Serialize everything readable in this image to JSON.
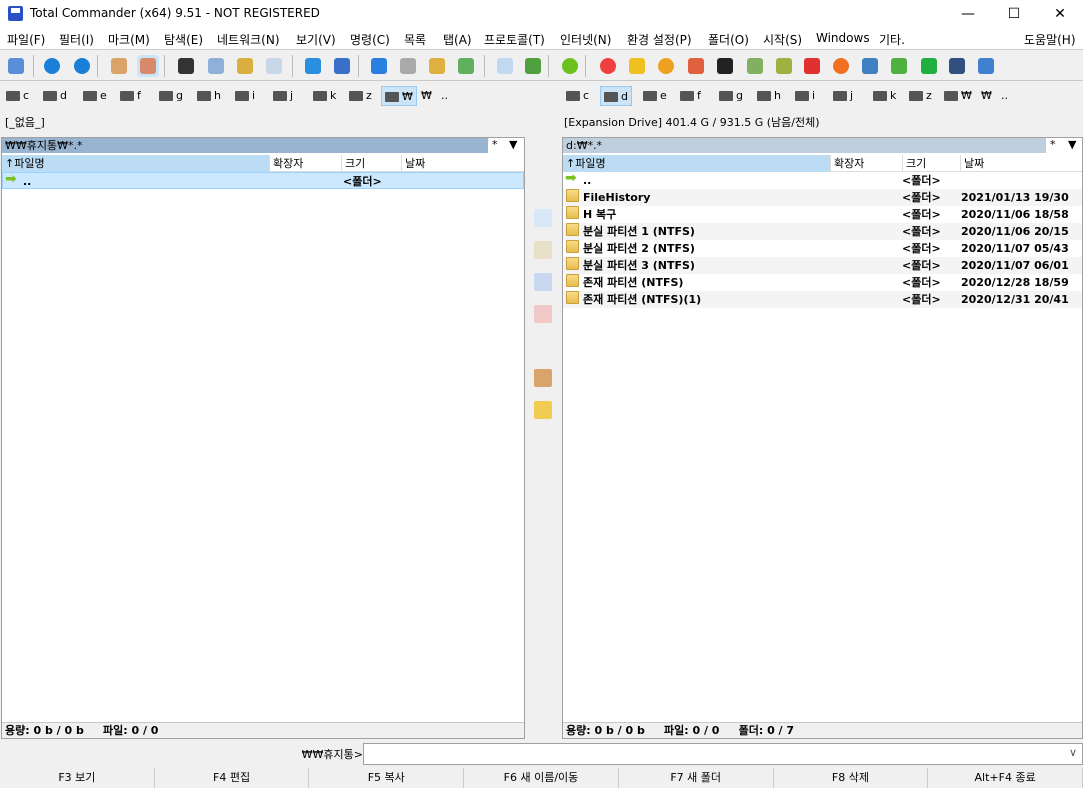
{
  "window": {
    "title": "Total Commander (x64) 9.51 - NOT REGISTERED",
    "minimize": "—",
    "maximize": "☐",
    "close": "✕"
  },
  "menu": [
    "파일(F)",
    "필터(I)",
    "마크(M)",
    "탐색(E)",
    "네트워크(N)",
    "보기(V)",
    "명령(C)",
    "목록",
    "탭(A)",
    "프로토콜(T)",
    "인터넷(N)",
    "환경 설정(P)",
    "폴더(O)",
    "시작(S)",
    "Windows",
    "기타.",
    "도움말(H)"
  ],
  "toolbar_icons": [
    "network-neighborhood-icon",
    "back-icon",
    "forward-icon",
    "pack-icon",
    "unpack-icon",
    "select-icon",
    "multi-rename-icon",
    "kb-icon",
    "attributes-icon",
    "internet-explorer-icon",
    "ftp-icon",
    "info-icon",
    "find-icon",
    "sync-icon",
    "compare-icon",
    "quick-view-icon",
    "image-icon",
    "green-circle-icon",
    "ring-icon",
    "player-icon",
    "launcher-icon",
    "eye-icon",
    "pdf-icon",
    "notepad-icon",
    "drop-icon",
    "paint-icon",
    "firefox-icon",
    "download-icon",
    "utorrent-icon",
    "64-icon",
    "terminal-icon",
    "settings-search-icon"
  ],
  "drives": [
    "c",
    "d",
    "e",
    "f",
    "g",
    "h",
    "i",
    "j",
    "k",
    "z",
    "₩",
    "₩",
    ".."
  ],
  "left": {
    "path_info": "[_없음_]",
    "header": "₩₩휴지통₩*.*",
    "star": "*",
    "columns": [
      "파일명",
      "확장자",
      "크기",
      "날짜"
    ],
    "rows": [
      {
        "name": "..",
        "size": "<폴더>",
        "date": ""
      }
    ],
    "status": "용량: 0 b / 0 b     파일: 0 / 0"
  },
  "right": {
    "path_info": "[Expansion Drive]  401.4 G / 931.5 G (남음/전체)",
    "header": "d:₩*.*",
    "star": "*",
    "columns": [
      "파일명",
      "확장자",
      "크기",
      "날짜"
    ],
    "rows": [
      {
        "name": "..",
        "size": "<폴더>",
        "date": ""
      },
      {
        "name": "FileHistory",
        "size": "<폴더>",
        "date": "2021/01/13 19/30"
      },
      {
        "name": "H 복구",
        "size": "<폴더>",
        "date": "2020/11/06 18/58"
      },
      {
        "name": "분실 파티션 1 (NTFS)",
        "size": "<폴더>",
        "date": "2020/11/06 20/15"
      },
      {
        "name": "분실 파티션 2 (NTFS)",
        "size": "<폴더>",
        "date": "2020/11/07 05/43"
      },
      {
        "name": "분실 파티션 3 (NTFS)",
        "size": "<폴더>",
        "date": "2020/11/07 06/01"
      },
      {
        "name": "존재 파티션 (NTFS)",
        "size": "<폴더>",
        "date": "2020/12/28 18/59"
      },
      {
        "name": "존재 파티션 (NTFS)(1)",
        "size": "<폴더>",
        "date": "2020/12/31 20/41"
      }
    ],
    "status": "용량: 0 b / 0 b     파일: 0 / 0     폴더: 0 / 7"
  },
  "cmdline": {
    "label": "₩₩휴지통>",
    "value": "",
    "dropdown": "∨"
  },
  "fkeys": [
    "F3 보기",
    "F4 편집",
    "F5 복사",
    "F6 새 이름/이동",
    "F7 새 폴더",
    "F8 삭제",
    "Alt+F4 종료"
  ]
}
